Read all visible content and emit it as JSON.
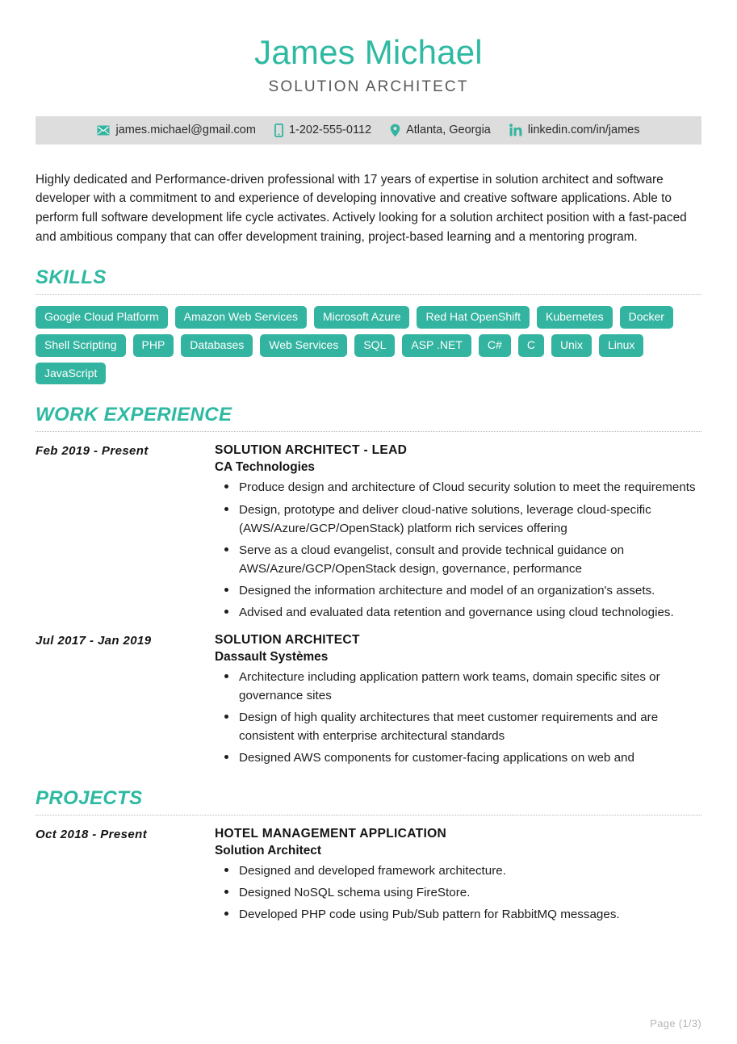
{
  "header": {
    "name": "James Michael",
    "job_title": "SOLUTION ARCHITECT",
    "name_color": "#2eb9a2",
    "title_color": "#585858"
  },
  "contact": {
    "bar_background": "#dddddd",
    "icon_color": "#33b4a0",
    "items": [
      {
        "icon": "envelope-icon",
        "text": "james.michael@gmail.com"
      },
      {
        "icon": "mobile-phone-icon",
        "text": "1-202-555-0112"
      },
      {
        "icon": "location-pin-icon",
        "text": "Atlanta, Georgia"
      },
      {
        "icon": "linkedin-icon",
        "text": "linkedin.com/in/james"
      }
    ]
  },
  "summary": {
    "text": "Highly dedicated and Performance-driven professional with 17 years of expertise in solution architect and software developer with a commitment to and experience of developing innovative and creative software applications. Able to perform full software development life cycle activates. Actively looking for a solution architect position with a fast-paced and ambitious company that can offer development training, project-based learning and a mentoring program."
  },
  "skills": {
    "section_title": "SKILLS",
    "tag_color": "#33b4a0",
    "tags": [
      "Google Cloud Platform",
      "Amazon Web Services",
      "Microsoft Azure",
      "Red Hat OpenShift",
      "Kubernetes",
      "Docker",
      "Shell Scripting",
      "PHP",
      "Databases",
      "Web Services",
      "SQL",
      "ASP .NET",
      "C#",
      "C",
      "Unix",
      "Linux",
      "JavaScript"
    ]
  },
  "work_experience": {
    "section_title": "WORK EXPERIENCE",
    "entries": [
      {
        "date": "Feb 2019 - Present",
        "role": "SOLUTION ARCHITECT - LEAD",
        "org": "CA Technologies",
        "bullets": [
          "Produce design and architecture of Cloud security solution to meet the requirements",
          "Design, prototype and deliver cloud-native solutions, leverage cloud-specific (AWS/Azure/GCP/OpenStack) platform rich services offering",
          "Serve as a cloud evangelist, consult and provide technical guidance on AWS/Azure/GCP/OpenStack design, governance, performance",
          "Designed the information architecture and model of an organization's assets.",
          "Advised and evaluated data retention and governance using cloud technologies."
        ]
      },
      {
        "date": "Jul 2017 - Jan 2019",
        "role": "SOLUTION ARCHITECT",
        "org": "Dassault Systèmes",
        "bullets": [
          "Architecture including application pattern work teams, domain specific sites or governance sites",
          "Design of high quality architectures that meet customer requirements and are consistent with enterprise architectural standards",
          "Designed AWS components for customer-facing applications on web and"
        ]
      }
    ]
  },
  "projects": {
    "section_title": "PROJECTS",
    "entries": [
      {
        "date": "Oct 2018 - Present",
        "role": "HOTEL MANAGEMENT APPLICATION",
        "org": "Solution Architect",
        "bullets": [
          "Designed and developed framework architecture.",
          "Designed NoSQL schema using FireStore.",
          "Developed PHP code using Pub/Sub pattern for RabbitMQ messages."
        ]
      }
    ]
  },
  "footer": {
    "page_label": "Page (1/3)"
  }
}
